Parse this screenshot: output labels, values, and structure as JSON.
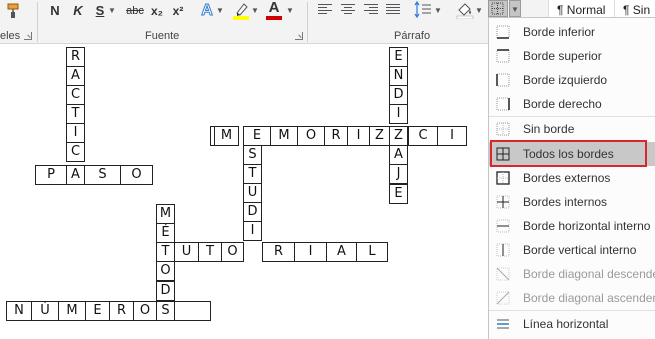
{
  "ribbon": {
    "font_group": {
      "bold": "N",
      "italic": "K",
      "underline": "S",
      "strikethrough": "abc",
      "subscript": "x₂",
      "superscript": "x²",
      "text_effect": "A",
      "font_color": "A",
      "label": "Fuente"
    },
    "clipboard_label_fragment": "eles",
    "paragraph_group": {
      "label": "Párrafo"
    },
    "styles": {
      "normal": "¶ Normal",
      "no_spacing": "¶ Sin"
    },
    "colors": {
      "highlight": "#ffff00",
      "font_color": "#d00000",
      "effect": "#2d7dd2"
    }
  },
  "crossword": {
    "vertical_words": [
      {
        "word": "RACTICA",
        "letters": [
          "R",
          "A",
          "C",
          "T",
          "I",
          "C",
          "A"
        ]
      },
      {
        "word": "ENDIZAJE",
        "letters": [
          "E",
          "N",
          "D",
          "I",
          "Z",
          "A",
          "J",
          "E"
        ]
      },
      {
        "word": "ESTUDIO",
        "letters": [
          "E",
          "S",
          "T",
          "U",
          "D",
          "I",
          "O"
        ]
      },
      {
        "word": "MÉTODOS",
        "letters": [
          "M",
          "É",
          "T",
          "O",
          "D",
          "O",
          "S"
        ]
      }
    ],
    "horizontal_words": [
      {
        "word": "MEMORIZACI",
        "letters": [
          "M",
          "E",
          "M",
          "O",
          "R",
          "I",
          "Z",
          "A",
          "C",
          "I"
        ]
      },
      {
        "word": "PASO",
        "letters": [
          "P",
          "A",
          "S",
          "O"
        ]
      },
      {
        "word": "TUTORIAL",
        "letters": [
          "T",
          "U",
          "T",
          "O",
          "R",
          "I",
          "A",
          "L"
        ]
      },
      {
        "word": "NÚMEROS",
        "letters": [
          "N",
          "Ú",
          "M",
          "E",
          "R",
          "O",
          "S"
        ]
      }
    ]
  },
  "borders_menu": {
    "items": [
      {
        "label": "Borde inferior",
        "icon": "border-bottom-icon",
        "state": "normal"
      },
      {
        "label": "Borde superior",
        "icon": "border-top-icon",
        "state": "normal"
      },
      {
        "label": "Borde izquierdo",
        "icon": "border-left-icon",
        "state": "normal"
      },
      {
        "label": "Borde derecho",
        "icon": "border-right-icon",
        "state": "normal"
      },
      {
        "label": "Sin borde",
        "icon": "no-border-icon",
        "state": "normal"
      },
      {
        "label": "Todos los bordes",
        "icon": "all-borders-icon",
        "state": "selected"
      },
      {
        "label": "Bordes externos",
        "icon": "outside-borders-icon",
        "state": "normal"
      },
      {
        "label": "Bordes internos",
        "icon": "inside-borders-icon",
        "state": "normal"
      },
      {
        "label": "Borde horizontal interno",
        "icon": "inside-horizontal-border-icon",
        "state": "normal"
      },
      {
        "label": "Borde vertical interno",
        "icon": "inside-vertical-border-icon",
        "state": "normal"
      },
      {
        "label": "Borde diagonal descende",
        "icon": "diagonal-down-border-icon",
        "state": "disabled"
      },
      {
        "label": "Borde diagonal ascenden",
        "icon": "diagonal-up-border-icon",
        "state": "disabled"
      },
      {
        "label": "Línea horizontal",
        "icon": "horizontal-line-icon",
        "state": "normal"
      }
    ],
    "highlight_color": "#d9262c"
  }
}
